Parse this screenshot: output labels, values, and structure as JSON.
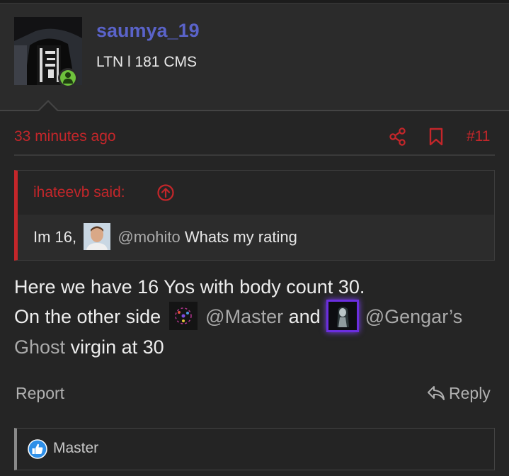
{
  "user": {
    "username": "saumya_19",
    "title": "LTN l 181 CMS"
  },
  "post": {
    "time": "33 minutes ago",
    "number": "#11",
    "quote": {
      "author": "ihateevb said:",
      "text_before": "Im 16,",
      "mention": "@mohito",
      "text_after": "Whats my rating"
    },
    "body": {
      "line1": "Here we have 16 Yos with body count 30.",
      "line2_a": "On the other side",
      "mention1": "@Master",
      "line2_b": "and",
      "mention2_a": "@Gengar’s",
      "mention2_b": "Ghost",
      "line3": "virgin at 30"
    },
    "actions": {
      "report": "Report",
      "reply": "Reply"
    },
    "reactions": {
      "user": "Master"
    }
  },
  "colors": {
    "accent": "#c4262a",
    "username": "#5a63c9",
    "online": "#6ec33c",
    "like": "#2e8fe8"
  },
  "icons": [
    "share-icon",
    "bookmark-icon",
    "arrow-up-icon",
    "reply-icon",
    "like-icon"
  ]
}
